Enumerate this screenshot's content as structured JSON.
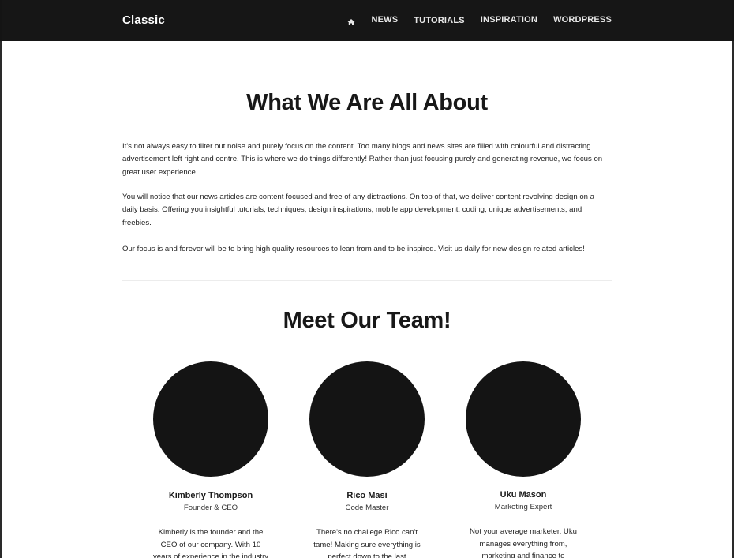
{
  "header": {
    "brand": "Classic",
    "nav": [
      {
        "icon": "home-icon"
      },
      {
        "label": "NEWS"
      },
      {
        "label": "TUTORIALS"
      },
      {
        "label": "INSPIRATION"
      },
      {
        "label": "WORDPRESS"
      }
    ]
  },
  "about": {
    "title": "What We Are All About",
    "paragraphs": [
      "It's not always easy to filter out noise and purely focus on the content. Too many blogs and news sites are filled with colourful and distracting advertisement left right and centre. This is where we do things differently! Rather than just focusing purely and generating revenue, we focus on great user experience.",
      "You will notice that our news articles are content focused and free of any distractions. On top of that, we deliver content revolving design on a daily basis. Offering you insightful tutorials, techniques, design inspirations, mobile app development, coding, unique advertisements, and freebies.",
      "Our focus is and forever will be to bring high quality resources to lean from and to be inspired. Visit us daily for new design related articles!"
    ]
  },
  "team": {
    "title": "Meet Our Team!",
    "members": [
      {
        "name": "Kimberly Thompson",
        "role": "Founder & CEO",
        "bio": "Kimberly is the founder and the CEO of our company. With 10 years of experience in the industry"
      },
      {
        "name": "Rico Masi",
        "role": "Code Master",
        "bio": "There's no challege Rico can't tame! Making sure everything is perfect down to the last"
      },
      {
        "name": "Uku Mason",
        "role": "Marketing Expert",
        "bio": "Not your average marketer. Uku manages everything from, marketing and finance to"
      }
    ]
  },
  "colors": {
    "navbar": "#161616",
    "background": "#ffffff",
    "avatar": "#141414",
    "text": "#181818"
  }
}
